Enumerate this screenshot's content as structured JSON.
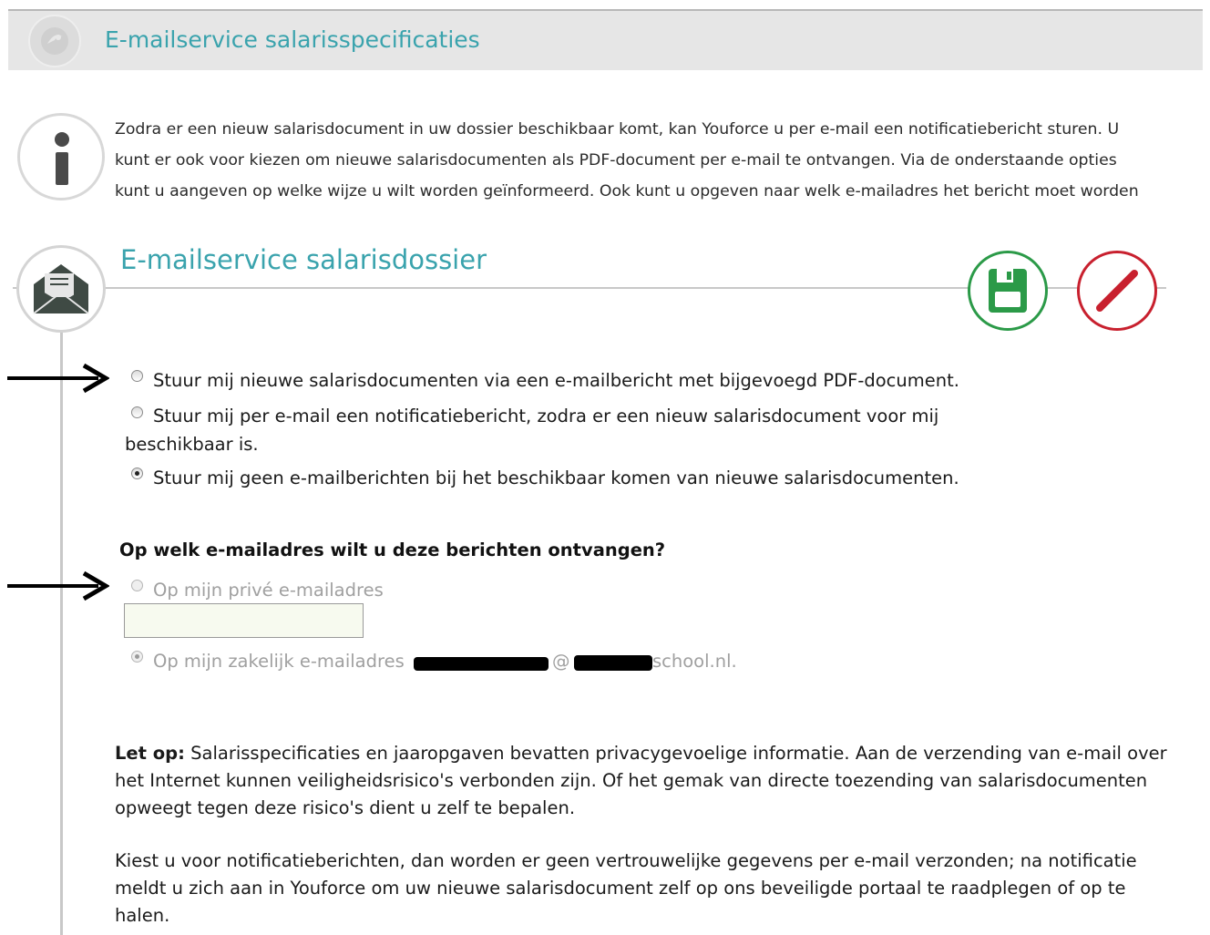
{
  "header": {
    "title": "E-mailservice salarisspecificaties"
  },
  "intro": {
    "lines": [
      "Zodra er een nieuw salarisdocument in uw dossier beschikbaar komt, kan Youforce u per e-mail een notificatiebericht sturen. U",
      "kunt er ook voor kiezen om nieuwe salarisdocumenten als PDF-document per e-mail te ontvangen. Via de onderstaande opties",
      "kunt u aangeven op welke wijze u wilt worden geïnformeerd. Ook kunt u opgeven naar welk e-mailadres het bericht moet worden"
    ]
  },
  "section": {
    "title": "E-mailservice salarisdossier"
  },
  "delivery_options": {
    "option_pdf": "Stuur mij nieuwe salarisdocumenten via een e-mailbericht met bijgevoegd PDF-document.",
    "option_notify_line1": "Stuur mij per e-mail een notificatiebericht, zodra er een nieuw salarisdocument voor mij",
    "option_notify_line2": "beschikbaar is.",
    "option_none": "Stuur mij geen e-mailberichten bij het beschikbaar komen van nieuwe salarisdocumenten.",
    "selected": "option_none"
  },
  "address": {
    "question": "Op welk e-mailadres wilt u deze berichten ontvangen?",
    "private_label": "Op mijn privé e-mailadres",
    "private_value": "",
    "business_label": "Op mijn zakelijk e-mailadres",
    "business_email_visible_at": "@",
    "business_email_visible_tail": "school.nl.",
    "selected": "business"
  },
  "note": {
    "bold_lead": "Let op:",
    "para1_line1": " Salarisspecificaties en jaaropgaven bevatten privacygevoelige informatie. Aan de verzending van e-mail over",
    "para1_line2": "het Internet kunnen veiligheidsrisico's verbonden zijn. Of het gemak van directe toezending van salarisdocumenten",
    "para1_line3": "opweegt tegen deze risico's dient u zelf te bepalen.",
    "para2_line1": "Kiest u voor notificatieberichten, dan worden er geen vertrouwelijke gegevens per e-mail verzonden; na notificatie",
    "para2_line2": "meldt u zich aan in Youforce om uw nieuwe salarisdocument zelf op ons beveiligde portaal te raadplegen of op te",
    "para2_line3": "halen."
  },
  "icons": {
    "logo": "youforce-logo-icon",
    "info": "info-icon",
    "mail": "envelope-icon",
    "save": "save-icon",
    "cancel": "cancel-icon",
    "arrow": "arrow-right-icon"
  },
  "colors": {
    "accent": "#3aa3ad",
    "save": "#2b9a48",
    "cancel": "#c8202e"
  }
}
